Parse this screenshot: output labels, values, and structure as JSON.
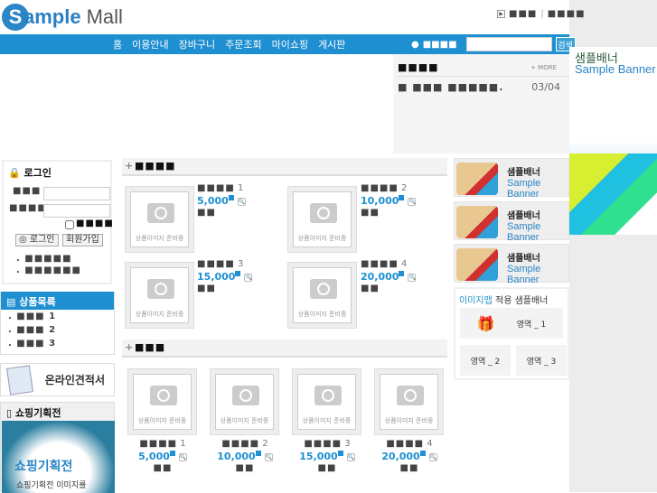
{
  "logo": {
    "s": "S",
    "ample": "ample",
    "mall": "Mall"
  },
  "toplinks": [
    "■■■",
    "|",
    "■■■■"
  ],
  "menu": [
    "홈",
    "이용안내",
    "장바구니",
    "주문조회",
    "마이쇼핑",
    "게시판"
  ],
  "search": {
    "label": "■■■■",
    "button": "검색",
    "value": ""
  },
  "notice": {
    "title": "■■■■",
    "more": "+ MORE",
    "item": "■ ■■■ ■■■■■.",
    "date": "03/04"
  },
  "banner": {
    "korean": "샘플배너",
    "english": "Sample Banner"
  },
  "login": {
    "title": "로그인",
    "id_label": "■■■",
    "pw_label": "■■■■",
    "remember": "■■■■",
    "login_btn": "◎ 로그인",
    "join_btn": "회원가입",
    "links": [
      ". ■■■■■",
      ". ■■■■■■"
    ]
  },
  "category": {
    "title": "상품목록",
    "items": [
      ". ■■■ 1",
      ". ■■■ 2",
      ". ■■■ 3"
    ]
  },
  "estimate": "온라인견적서",
  "planning": {
    "title": "쇼핑기획전",
    "banner_title": "쇼핑기획전",
    "banner_sub": "쇼핑기획전 이미지를"
  },
  "section1": {
    "title": "■■■■",
    "products": [
      {
        "name": "■■■■",
        "num": "1",
        "price": "5,000",
        "sub": "■■"
      },
      {
        "name": "■■■■",
        "num": "2",
        "price": "10,000",
        "sub": "■■"
      },
      {
        "name": "■■■■",
        "num": "3",
        "price": "15,000",
        "sub": "■■"
      },
      {
        "name": "■■■■",
        "num": "4",
        "price": "20,000",
        "sub": "■■"
      }
    ]
  },
  "section2": {
    "title": "■■■",
    "products": [
      {
        "name": "■■■■",
        "num": "1",
        "price": "5,000",
        "sub": "■■"
      },
      {
        "name": "■■■■",
        "num": "2",
        "price": "10,000",
        "sub": "■■"
      },
      {
        "name": "■■■■",
        "num": "3",
        "price": "15,000",
        "sub": "■■"
      },
      {
        "name": "■■■■",
        "num": "4",
        "price": "20,000",
        "sub": "■■"
      }
    ]
  },
  "image_caption": "상품이미지 준비중",
  "side_banners": [
    {
      "korean": "샘플배너",
      "english": "Sample Banner"
    },
    {
      "korean": "샘플배너",
      "english": "Sample Banner"
    },
    {
      "korean": "샘플배너",
      "english": "Sample Banner"
    }
  ],
  "imagemap": {
    "title_em": "이미지맵",
    "title_rest": " 적용 샘플배너",
    "areas": [
      "영역 _ 1",
      "영역 _ 2",
      "영역 _ 3"
    ]
  }
}
